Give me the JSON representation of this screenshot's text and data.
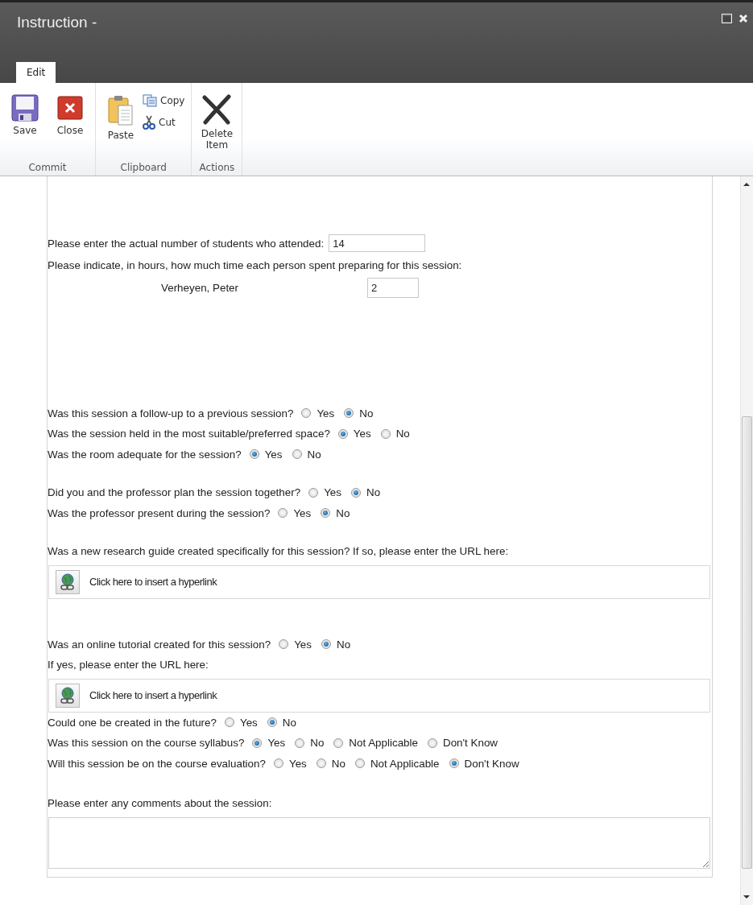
{
  "window": {
    "title": "Instruction -"
  },
  "tabs": [
    {
      "label": "Edit",
      "selected": true
    }
  ],
  "ribbon": {
    "groups": [
      {
        "label": "Commit",
        "buttons": [
          {
            "kind": "save",
            "label": "Save"
          },
          {
            "kind": "close",
            "label": "Close"
          }
        ]
      },
      {
        "label": "Clipboard",
        "buttons": [
          {
            "kind": "paste",
            "label": "Paste"
          },
          {
            "kind": "copy",
            "label": "Copy"
          },
          {
            "kind": "cut",
            "label": "Cut"
          }
        ]
      },
      {
        "label": "Actions",
        "buttons": [
          {
            "kind": "delete",
            "label": "Delete Item"
          }
        ]
      }
    ]
  },
  "form": {
    "sections": [
      {
        "items": [
          {
            "kind": "number",
            "label": "Please enter the actual number of students who attended:",
            "value": "14"
          },
          {
            "kind": "text",
            "label": "Please indicate, in hours, how much time each person spent preparing for this session:"
          },
          {
            "kind": "person",
            "label": "Verheyen, Peter",
            "value": "2"
          }
        ]
      },
      {
        "items": [
          {
            "kind": "radio",
            "label": "Was this session a follow-up to a previous session?",
            "options": [
              {
                "label": "Yes",
                "selected": false
              },
              {
                "label": "No",
                "selected": true
              }
            ]
          },
          {
            "kind": "radio",
            "label": "Was the session held in the most suitable/preferred space?",
            "options": [
              {
                "label": "Yes",
                "selected": true
              },
              {
                "label": "No",
                "selected": false
              }
            ]
          },
          {
            "kind": "radio",
            "label": "Was the room adequate for the session?",
            "options": [
              {
                "label": "Yes",
                "selected": true
              },
              {
                "label": "No",
                "selected": false
              }
            ]
          }
        ]
      },
      {
        "items": [
          {
            "kind": "radio",
            "label": "Did you and the professor plan the session together?",
            "options": [
              {
                "label": "Yes",
                "selected": false
              },
              {
                "label": "No",
                "selected": true
              }
            ]
          },
          {
            "kind": "radio",
            "label": "Was the professor present during the session?",
            "options": [
              {
                "label": "Yes",
                "selected": false
              },
              {
                "label": "No",
                "selected": true
              }
            ]
          }
        ]
      },
      {
        "items": [
          {
            "kind": "text",
            "label": "Was a new research guide created specifically for this session?  If so, please enter the URL here:"
          },
          {
            "kind": "hyperlink",
            "label": "Click here to insert a hyperlink"
          }
        ]
      },
      {
        "items": [
          {
            "kind": "radio",
            "label": "Was an online tutorial created for this session?",
            "options": [
              {
                "label": "Yes",
                "selected": false
              },
              {
                "label": "No",
                "selected": true
              }
            ]
          },
          {
            "kind": "text",
            "label": "If yes, please enter the URL here:"
          },
          {
            "kind": "hyperlink",
            "label": "Click here to insert a hyperlink"
          },
          {
            "kind": "radio",
            "label": "Could one be created in the future?",
            "options": [
              {
                "label": "Yes",
                "selected": false
              },
              {
                "label": "No",
                "selected": true
              }
            ]
          },
          {
            "kind": "radio",
            "label": "Was this session on the course syllabus?",
            "options": [
              {
                "label": "Yes",
                "selected": true
              },
              {
                "label": "No",
                "selected": false
              },
              {
                "label": "Not Applicable",
                "selected": false
              },
              {
                "label": "Don't Know",
                "selected": false
              }
            ]
          },
          {
            "kind": "radio",
            "label": "Will this session be on the course evaluation?",
            "options": [
              {
                "label": "Yes",
                "selected": false
              },
              {
                "label": "No",
                "selected": false
              },
              {
                "label": "Not Applicable",
                "selected": false
              },
              {
                "label": "Don't Know",
                "selected": true
              }
            ]
          }
        ]
      },
      {
        "items": [
          {
            "kind": "text",
            "label": "Please enter any comments about the session:"
          },
          {
            "kind": "textarea"
          }
        ]
      }
    ]
  }
}
